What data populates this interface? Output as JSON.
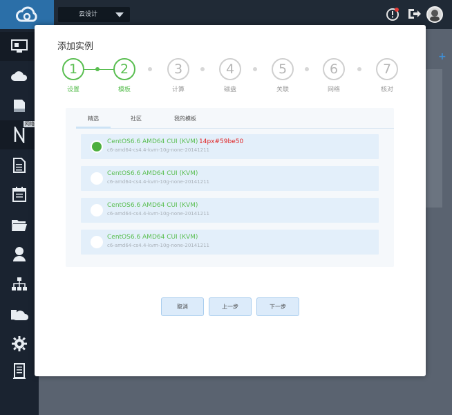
{
  "topbar": {
    "project_select": "云设计",
    "icons": [
      "alert-icon",
      "logout-icon",
      "avatar"
    ]
  },
  "sidebar": {
    "items": [
      "console-icon",
      "cloud-icon",
      "storage-icon",
      "network-icon",
      "document-icon",
      "calendar-icon",
      "folder-icon",
      "user-icon",
      "topology-icon",
      "cloud-image-icon",
      "gear-icon",
      "log-icon"
    ],
    "tooltip": "网络"
  },
  "modal": {
    "title": "添加实例",
    "steps": [
      {
        "num": "1",
        "label": "设置",
        "done": true
      },
      {
        "num": "2",
        "label": "模板",
        "done": true
      },
      {
        "num": "3",
        "label": "计算",
        "done": false
      },
      {
        "num": "4",
        "label": "磁盘",
        "done": false
      },
      {
        "num": "5",
        "label": "关联",
        "done": false
      },
      {
        "num": "6",
        "label": "网络",
        "done": false
      },
      {
        "num": "7",
        "label": "核对",
        "done": false
      }
    ],
    "tabs": [
      "精选",
      "社区",
      "我的模板"
    ],
    "templates": [
      {
        "name": "CentOS6.6 AMD64 CUI (KVM)",
        "sub": "c6-amd64-cs4.4-kvm-10g-none-20141211",
        "selected": true,
        "note": "14px#59be50"
      },
      {
        "name": "CentOS6.6 AMD64 CUI (KVM)",
        "sub": "c6-amd64-cs4.4-kvm-10g-none-20141211",
        "selected": false,
        "note": ""
      },
      {
        "name": "CentOS6.6 AMD64 CUI (KVM)",
        "sub": "c6-amd64-cs4.4-kvm-10g-none-20141211",
        "selected": false,
        "note": ""
      },
      {
        "name": "CentOS6.6 AMD64 CUI (KVM)",
        "sub": "c6-amd64-cs4.4-kvm-10g-none-20141211",
        "selected": false,
        "note": ""
      }
    ],
    "buttons": {
      "cancel": "取消",
      "prev": "上一步",
      "next": "下一步"
    }
  },
  "colors": {
    "accent_green": "#59be50",
    "note_red": "#e02020",
    "topbar": "#202a36",
    "sidebar": "#1a2330"
  }
}
